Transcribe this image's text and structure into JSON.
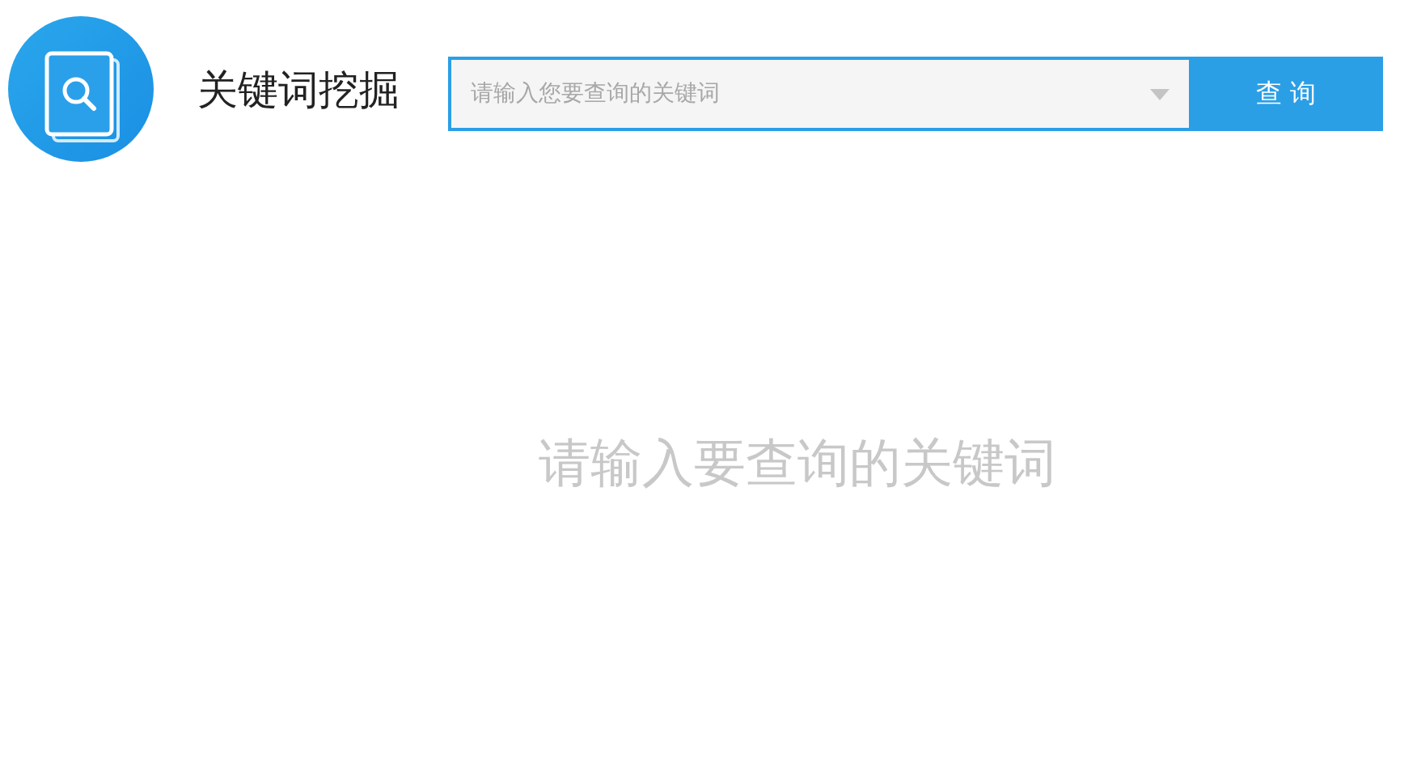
{
  "header": {
    "title": "关键词挖掘"
  },
  "search": {
    "placeholder": "请输入您要查询的关键词",
    "button": "查 询"
  },
  "empty_message": "请输入要查询的关键词"
}
